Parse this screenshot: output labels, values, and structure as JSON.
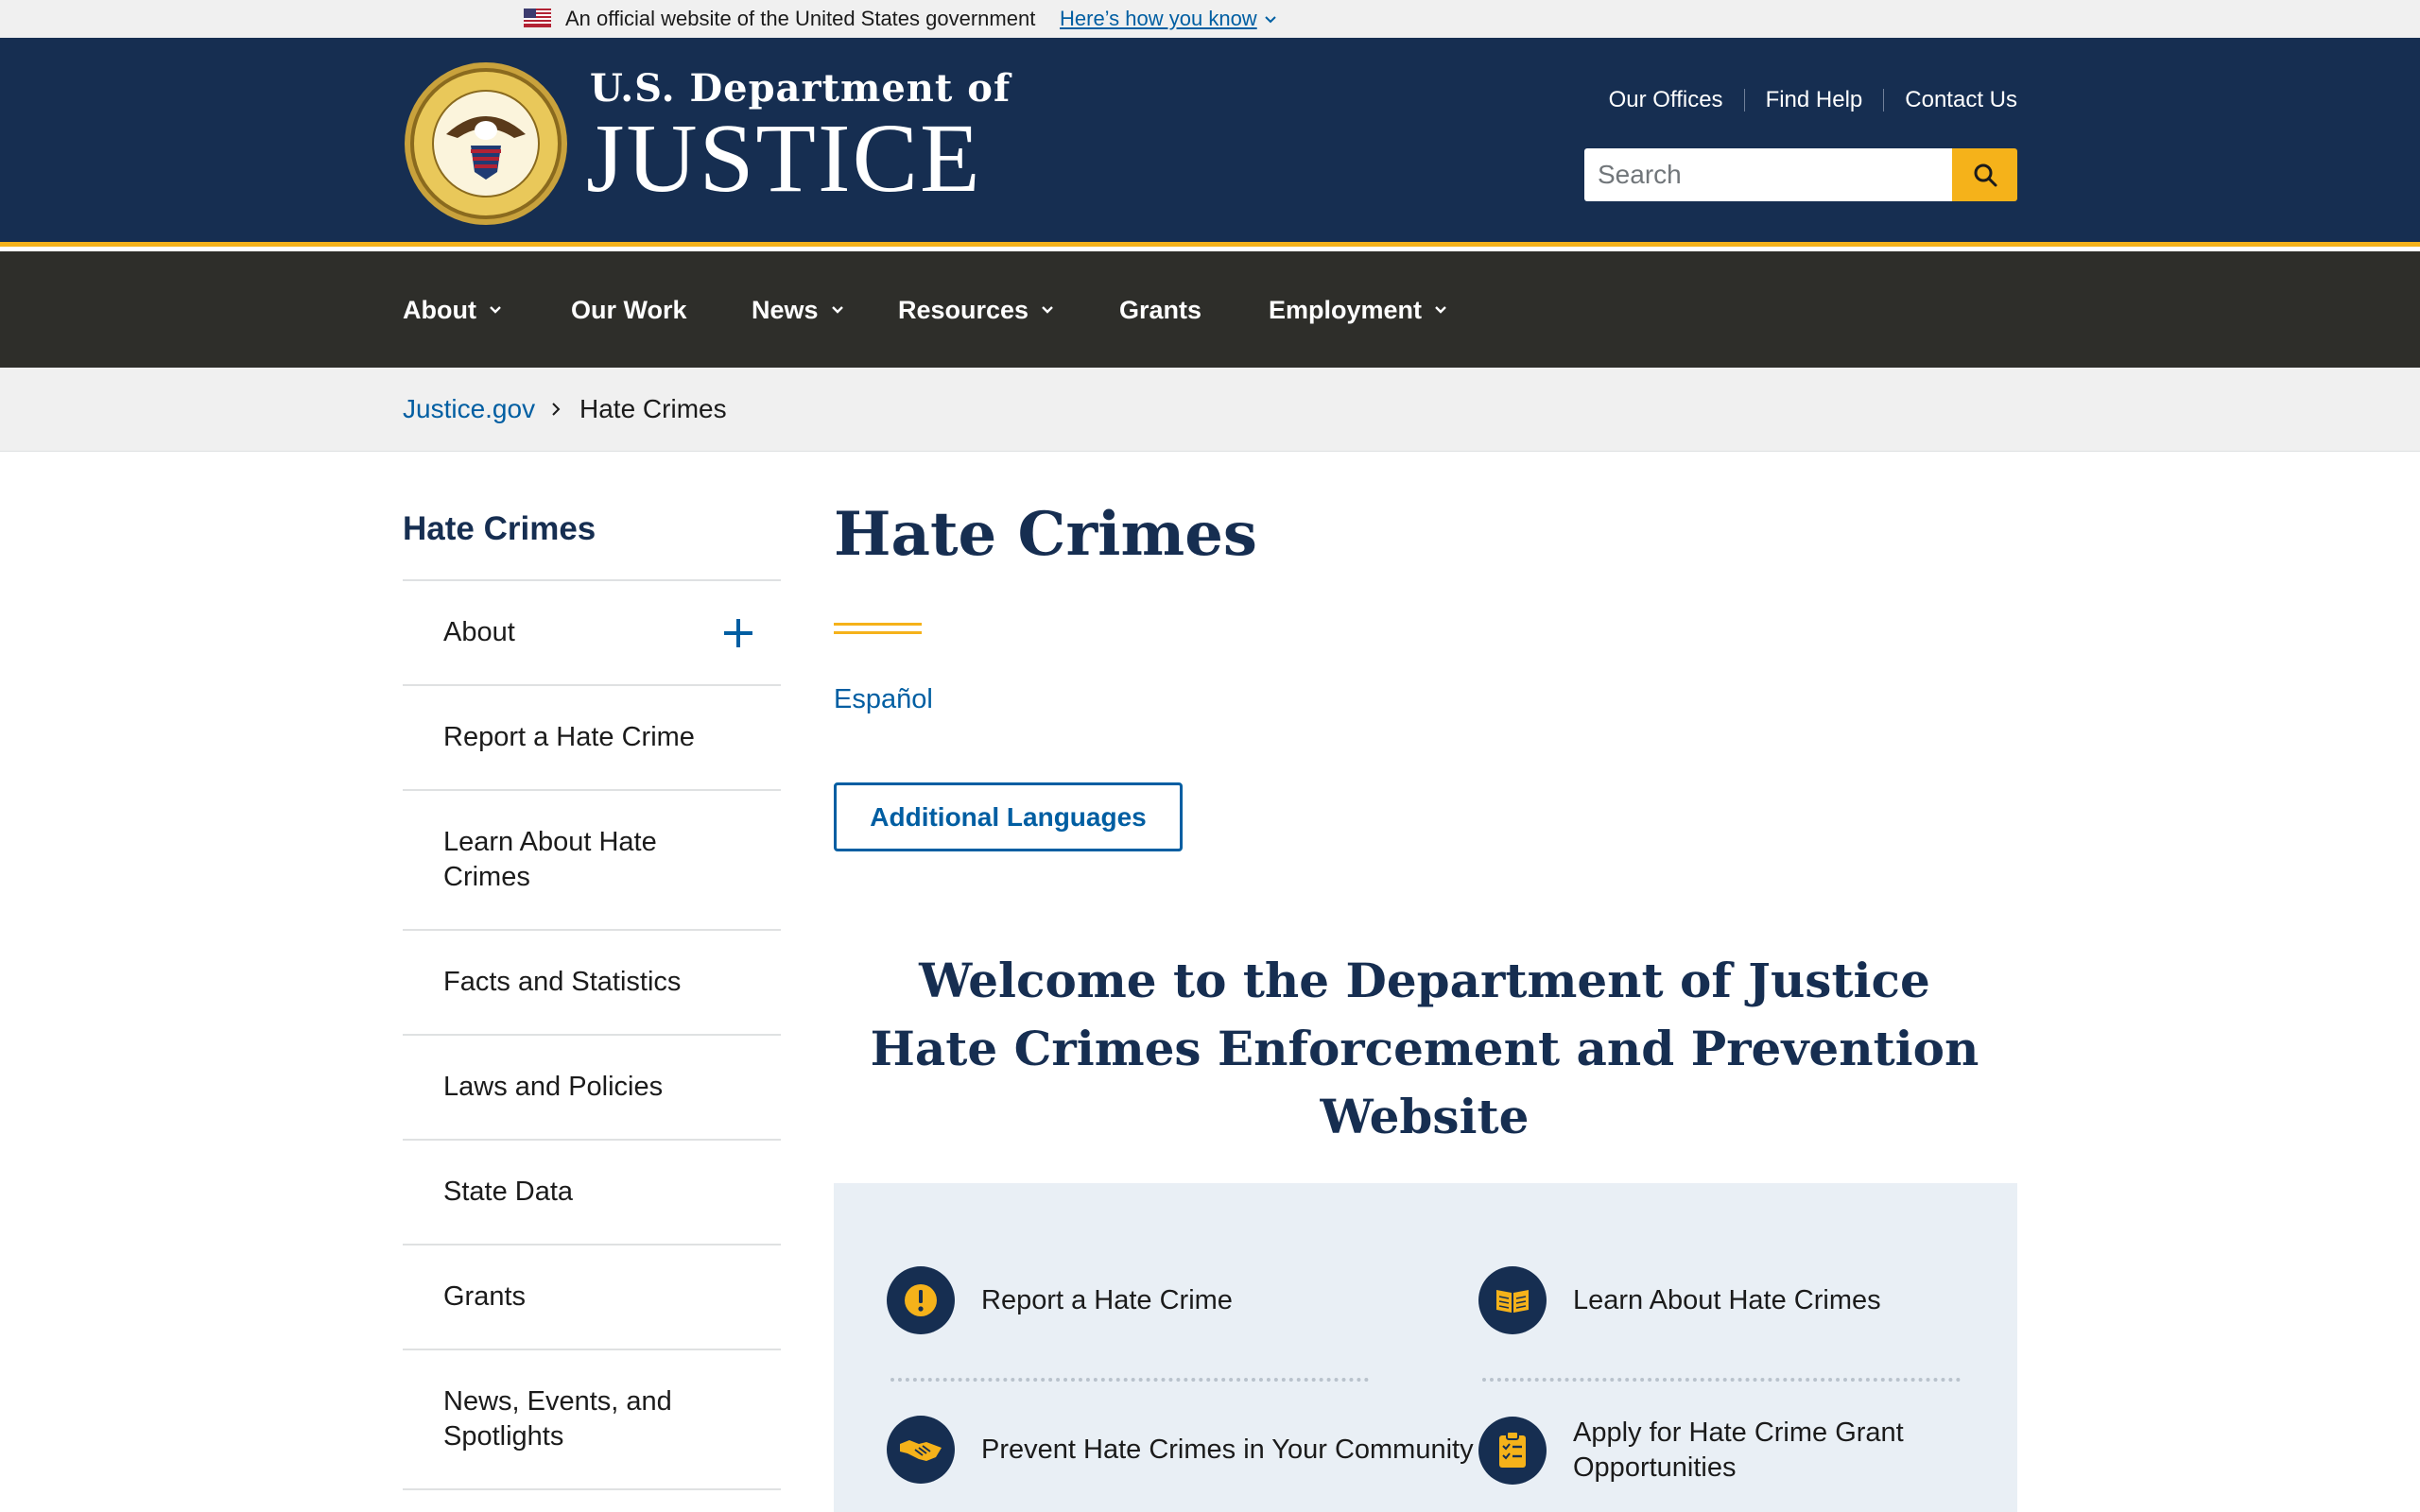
{
  "gov_banner": {
    "text": "An official website of the United States government",
    "link": "Here’s how you know"
  },
  "header": {
    "logo_line1": "U.S. Department of",
    "logo_line2": "JUSTICE",
    "utility_links": [
      "Our Offices",
      "Find Help",
      "Contact Us"
    ],
    "search_placeholder": "Search"
  },
  "main_nav": [
    {
      "label": "About",
      "has_dropdown": true
    },
    {
      "label": "Our Work",
      "has_dropdown": false
    },
    {
      "label": "News",
      "has_dropdown": true
    },
    {
      "label": "Resources",
      "has_dropdown": true
    },
    {
      "label": "Grants",
      "has_dropdown": false
    },
    {
      "label": "Employment",
      "has_dropdown": true
    }
  ],
  "breadcrumb": {
    "home": "Justice.gov",
    "current": "Hate Crimes"
  },
  "sidebar": {
    "title": "Hate Crimes",
    "items": [
      {
        "label": "About",
        "expandable": true
      },
      {
        "label": "Report a Hate Crime"
      },
      {
        "label": "Learn About Hate Crimes"
      },
      {
        "label": "Facts and Statistics"
      },
      {
        "label": "Laws and Policies"
      },
      {
        "label": "State Data"
      },
      {
        "label": "Grants"
      },
      {
        "label": "News, Events, and Spotlights"
      }
    ]
  },
  "content": {
    "title": "Hate Crimes",
    "espanol_link": "Español",
    "languages_button": "Additional Languages",
    "welcome_heading": "Welcome to the Department of Justice Hate Crimes Enforcement and Prevention Website"
  },
  "quick_links": [
    {
      "label": "Report a Hate Crime",
      "icon": "exclamation-icon"
    },
    {
      "label": "Learn About Hate Crimes",
      "icon": "book-icon"
    },
    {
      "label": "Prevent Hate Crimes in Your Community",
      "icon": "handshake-icon"
    },
    {
      "label": "Apply for Hate Crime Grant Opportunities",
      "icon": "checklist-icon"
    }
  ],
  "colors": {
    "navy": "#162e51",
    "gold": "#f5b21a",
    "nav_dark": "#2e2e2a",
    "link_blue": "#005ea2",
    "card_bg": "#e9eff5"
  }
}
